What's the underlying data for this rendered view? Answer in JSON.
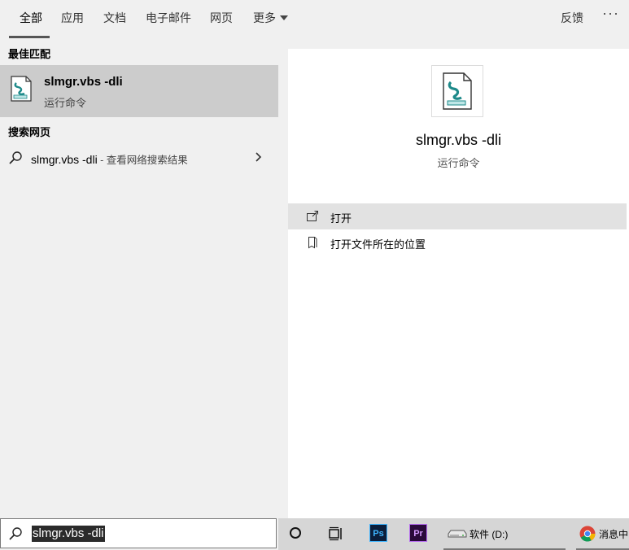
{
  "tabs": [
    {
      "label": "全部",
      "active": true
    },
    {
      "label": "应用"
    },
    {
      "label": "文档"
    },
    {
      "label": "电子邮件"
    },
    {
      "label": "网页"
    },
    {
      "label": "更多"
    }
  ],
  "header": {
    "feedback": "反馈",
    "more_menu": "···"
  },
  "left": {
    "best_match_label": "最佳匹配",
    "best_match": {
      "title": "slmgr.vbs -dli",
      "subtitle": "运行命令",
      "icon": "script-file-icon"
    },
    "web_label": "搜索网页",
    "web_item": {
      "query": "slmgr.vbs -dli",
      "suffix": " - 查看网络搜索结果",
      "icon": "search-icon"
    }
  },
  "preview": {
    "title": "slmgr.vbs -dli",
    "subtitle": "运行命令",
    "icon": "script-file-icon",
    "actions": [
      {
        "label": "打开",
        "icon": "open-icon"
      },
      {
        "label": "打开文件所在的位置",
        "icon": "file-location-icon"
      }
    ]
  },
  "search": {
    "value": "slmgr.vbs -dli"
  },
  "taskbar": {
    "ps_label": "Ps",
    "pr_label": "Pr",
    "drive_label": "软件 (D:)",
    "chrome_label": "消息中"
  },
  "colors": {
    "selected_row": "#cccccc",
    "hover_row": "#e2e2e2",
    "pane_bg": "#f0f0f0"
  }
}
